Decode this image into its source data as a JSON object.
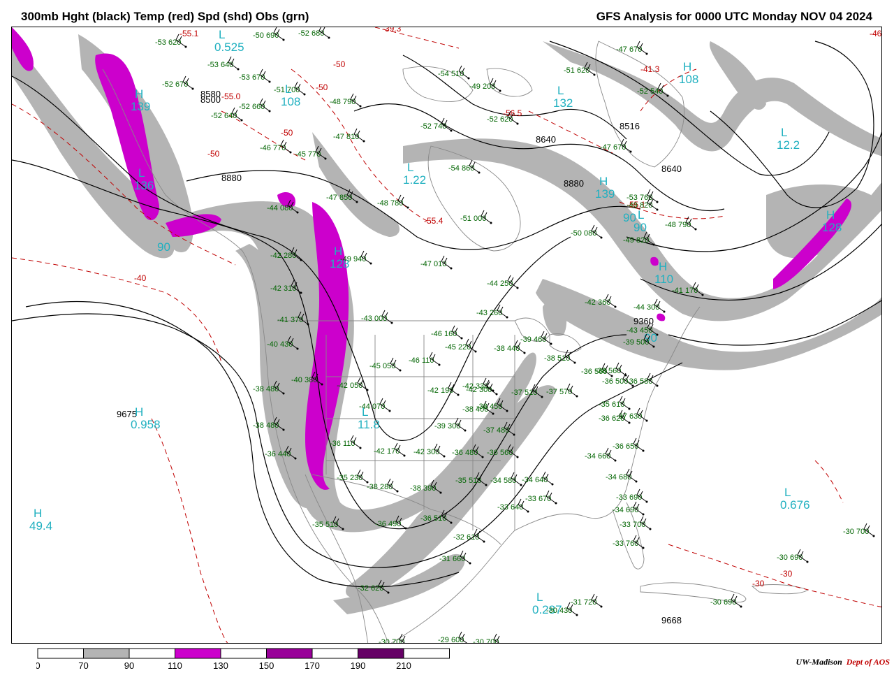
{
  "header": {
    "title_left": "300mb Hght (black) Temp (red) Spd (shd) Obs (grn)",
    "title_right": "GFS Analysis for 0000 UTC Monday  NOV 04 2024"
  },
  "colors": {
    "height_contours": "#000000",
    "temp_contours": "#c00000",
    "obs_text": "#006400",
    "speed_70_90": "#b4b4b4",
    "speed_110_130": "#cc00cc",
    "speed_150_170": "#990099",
    "speed_190_210": "#660066",
    "pressure_centers": "#20b0c0",
    "map_outlines": "#888888"
  },
  "legend": {
    "ticks": [
      "0",
      "70",
      "90",
      "110",
      "130",
      "150",
      "170",
      "190",
      "210"
    ],
    "fills": [
      "#ffffff",
      "#b4b4b4",
      "#ffffff",
      "#cc00cc",
      "#ffffff",
      "#990099",
      "#ffffff",
      "#660066",
      "#ffffff"
    ]
  },
  "credit": {
    "left": "UW-Madison",
    "right": "Dept of AOS"
  },
  "map": {
    "height_labels": [
      "8580",
      "8500",
      "8880",
      "8640",
      "8640",
      "8880",
      "8516",
      "9360",
      "9675",
      "9668"
    ],
    "temp_labels": [
      "-55.1",
      "-55.0",
      "-50",
      "-50",
      "-50",
      "-50",
      "-40",
      "-39.3",
      "-56.5",
      "-55.4",
      "-55.1",
      "-41.3",
      "-30",
      "-30",
      "-46"
    ],
    "centers": [
      {
        "letter": "L",
        "value": "0.525"
      },
      {
        "letter": "L",
        "value": "108"
      },
      {
        "letter": "H",
        "value": "139"
      },
      {
        "letter": "L",
        "value": "136"
      },
      {
        "letter": "L",
        "value": "1.22"
      },
      {
        "letter": "H",
        "value": "128"
      },
      {
        "letter": "L",
        "value": "11.8"
      },
      {
        "letter": "H",
        "value": "0.958"
      },
      {
        "letter": "H",
        "value": "49.4"
      },
      {
        "letter": "L",
        "value": "132"
      },
      {
        "letter": "H",
        "value": "108"
      },
      {
        "letter": "L",
        "value": "12.2"
      },
      {
        "letter": "H",
        "value": "128"
      },
      {
        "letter": "L",
        "value": "0.676"
      },
      {
        "letter": "L",
        "value": "0.287"
      },
      {
        "letter": "H",
        "value": "139"
      },
      {
        "letter": "H",
        "value": "110"
      },
      {
        "letter": "L",
        "value": "90"
      }
    ],
    "speed_labels": [
      "90",
      "90",
      "90"
    ],
    "observations": [
      "-53 620",
      "-52 680",
      "-50 690",
      "-53 640",
      "-53 670",
      "-52 670",
      "-51 700",
      "-52 660",
      "-52 640",
      "-48 790",
      "-47 810",
      "-46 770",
      "-45 770",
      "-47 850",
      "-48 780",
      "-44 080",
      "-42 280",
      "-42 310",
      "-41 370",
      "-40 430",
      "-40 380",
      "-38 480",
      "-38 480",
      "-36 440",
      "-49 940",
      "-43 000",
      "-45 050",
      "-42 050",
      "-44 070",
      "-36 110",
      "-35 230",
      "-35 510",
      "-54 860",
      "-51 000",
      "-47 010",
      "-44 250",
      "-43 260",
      "-46 160",
      "-45 220",
      "-46 110",
      "-42 190",
      "-42 330",
      "-38 440",
      "-39 460",
      "-38 510",
      "-42 300",
      "-38 400",
      "-39 300",
      "-38 450",
      "-37 510",
      "-37 570",
      "-36 560",
      "-37 480",
      "-42 170",
      "-38 280",
      "-38 390",
      "-42 300",
      "-36 480",
      "-36 560",
      "-35 510",
      "-34 580",
      "-33 640",
      "-33 670",
      "-34 640",
      "-36 490",
      "-36 510",
      "-32 610",
      "-31 660",
      "-32 620",
      "-30 700",
      "-29 600",
      "-30 700",
      "-31 720",
      "-30 430",
      "-52 740",
      "-52 620",
      "-51 620",
      "-47 670",
      "-52 540",
      "-53 760",
      "-48 790",
      "-49 820",
      "-50 080",
      "-42 360",
      "-44 300",
      "-43 450",
      "-39 500",
      "-38 560",
      "-36 500",
      "-36 580",
      "-35 610",
      "-36 620",
      "-37 630",
      "-36 650",
      "-34 660",
      "-34 680",
      "-33 690",
      "-34 690",
      "-33 700",
      "-33 760",
      "-30 700",
      "-30 690",
      "-30 690",
      "-54 510",
      "-49 200",
      "-49 820",
      "-41 170",
      "-47 670"
    ]
  }
}
